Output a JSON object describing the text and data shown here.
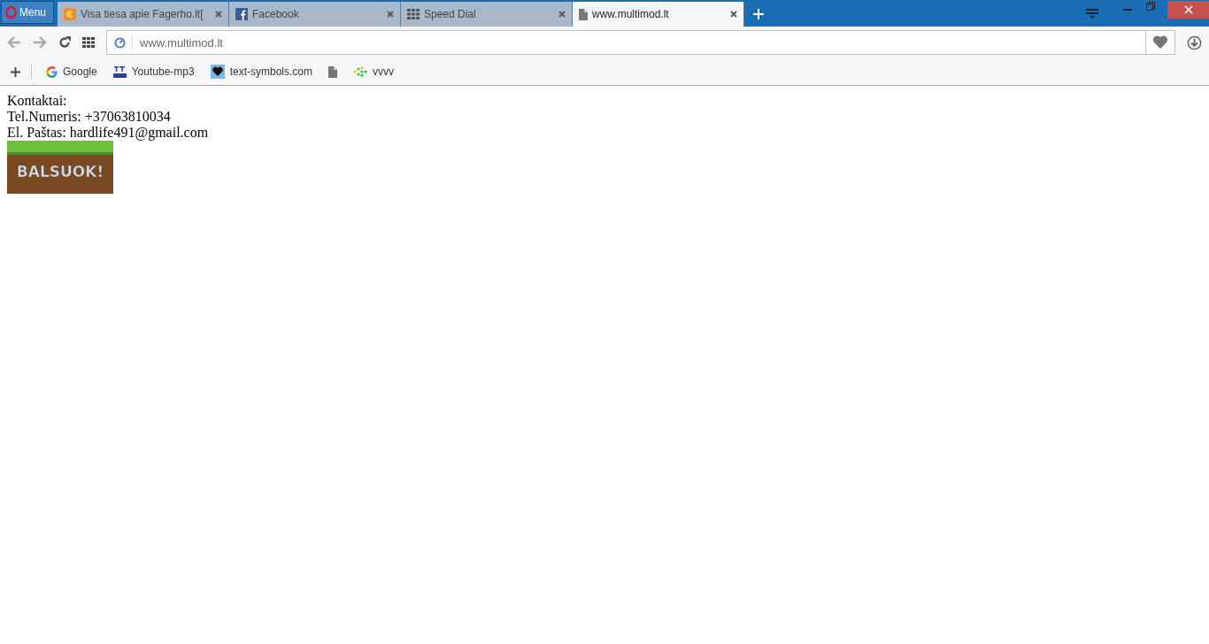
{
  "menu_button": {
    "label": "Menu"
  },
  "tabs": [
    {
      "title": "Visa tiesa apie Fagerho.lt[",
      "selected": false
    },
    {
      "title": "Facebook",
      "selected": false
    },
    {
      "title": "Speed Dial",
      "selected": false
    },
    {
      "title": "www.multimod.lt",
      "selected": true
    }
  ],
  "address_bar": {
    "value": "www.multimod.lt"
  },
  "bookmarks": [
    {
      "kind": "labeled",
      "label": "Google"
    },
    {
      "kind": "labeled",
      "label": "Youtube-mp3"
    },
    {
      "kind": "labeled",
      "label": "text-symbols.com"
    },
    {
      "kind": "icon"
    },
    {
      "kind": "labeled",
      "label": "vvvv"
    }
  ],
  "page": {
    "lines": [
      "Kontaktai:",
      "Tel.Numeris: +37063810034",
      "El. Paštas: hardlife491@gmail.com"
    ],
    "banner": "BALSUOK!"
  }
}
